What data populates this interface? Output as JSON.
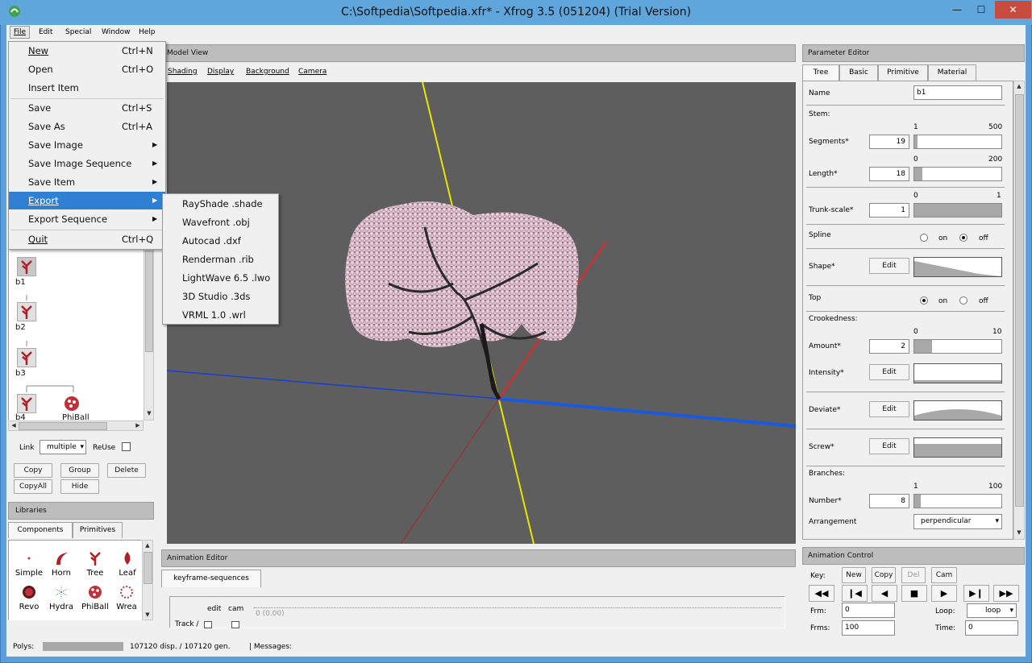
{
  "window": {
    "title": "C:\\Softpedia\\Softpedia.xfr* - Xfrog 3.5 (051204) (Trial Version)",
    "minimize": "—",
    "maximize": "☐",
    "close": "✕"
  },
  "menubar": [
    "File",
    "Edit",
    "Special",
    "Window",
    "Help"
  ],
  "file_menu": {
    "items": [
      {
        "label": "New",
        "shortcut": "Ctrl+N"
      },
      {
        "label": "Open",
        "shortcut": "Ctrl+O"
      },
      {
        "label": "Insert Item",
        "shortcut": ""
      },
      {
        "label": "Save",
        "shortcut": "Ctrl+S"
      },
      {
        "label": "Save As",
        "shortcut": "Ctrl+A"
      },
      {
        "label": "Save Image",
        "shortcut": ""
      },
      {
        "label": "Save Image Sequence",
        "shortcut": ""
      },
      {
        "label": "Save Item",
        "shortcut": ""
      },
      {
        "label": "Export",
        "shortcut": ""
      },
      {
        "label": "Export Sequence",
        "shortcut": ""
      },
      {
        "label": "Quit",
        "shortcut": "Ctrl+Q"
      }
    ],
    "submenu_arrow": "▶"
  },
  "export_submenu": [
    "RayShade .shade",
    "Wavefront .obj",
    "Autocad .dxf",
    "Renderman .rib",
    "LightWave 6.5 .lwo",
    "3D Studio .3ds",
    "VRML 1.0 .wrl"
  ],
  "hierarchy": {
    "nodes": [
      "b1",
      "b2",
      "b3",
      "b4",
      "PhiBall"
    ],
    "link_label": "Link",
    "link_value": "multiple",
    "reuse_label": "ReUse",
    "buttons": {
      "copy": "Copy",
      "group": "Group",
      "delete": "Delete",
      "copyall": "CopyAll",
      "hide": "Hide"
    }
  },
  "libraries": {
    "title": "Libraries",
    "tabs": [
      "Components",
      "Primitives"
    ],
    "items": [
      "Simple",
      "Horn",
      "Tree",
      "Leaf",
      "Revo",
      "Hydra",
      "PhiBall",
      "Wrea"
    ]
  },
  "model_view": {
    "title": "Model View",
    "menu": [
      "Shading",
      "Display",
      "Background",
      "Camera"
    ]
  },
  "animation_editor": {
    "title": "Animation Editor",
    "tab": "keyframe-sequences",
    "edit": "edit",
    "cam": "cam",
    "track": "Track /",
    "time": "0 (0.00)"
  },
  "parameter_editor": {
    "title": "Parameter Editor",
    "tabs": [
      "Tree",
      "Basic",
      "Primitive",
      "Material"
    ],
    "name_label": "Name",
    "name_value": "b1",
    "stem_label": "Stem:",
    "segments": {
      "label": "Segments*",
      "value": "19",
      "min": "1",
      "max": "500",
      "fraction": 0.036
    },
    "length": {
      "label": "Length*",
      "value": "18",
      "min": "0",
      "max": "200",
      "fraction": 0.09
    },
    "trunk_scale": {
      "label": "Trunk-scale*",
      "value": "1",
      "min": "0",
      "max": "1",
      "fraction": 1.0
    },
    "spline": {
      "label": "Spline",
      "on": "on",
      "off": "off",
      "selected": "off"
    },
    "shape": {
      "label": "Shape*",
      "button": "Edit"
    },
    "top": {
      "label": "Top",
      "on": "on",
      "off": "off",
      "selected": "on"
    },
    "crookedness_label": "Crookedness:",
    "amount": {
      "label": "Amount*",
      "value": "2",
      "min": "0",
      "max": "10",
      "fraction": 0.2
    },
    "intensity": {
      "label": "Intensity*",
      "button": "Edit"
    },
    "deviate": {
      "label": "Deviate*",
      "button": "Edit"
    },
    "screw": {
      "label": "Screw*",
      "button": "Edit"
    },
    "branches_label": "Branches:",
    "number": {
      "label": "Number*",
      "value": "8",
      "min": "1",
      "max": "100",
      "fraction": 0.07
    },
    "arrangement": {
      "label": "Arrangement",
      "value": "perpendicular"
    }
  },
  "animation_control": {
    "title": "Animation Control",
    "key_label": "Key:",
    "new": "New",
    "copy": "Copy",
    "del": "Del",
    "cam": "Cam",
    "frm_label": "Frm:",
    "frm_value": "0",
    "frms_label": "Frms:",
    "frms_value": "100",
    "loop_label": "Loop:",
    "loop_value": "loop",
    "time_label": "Time:",
    "time_value": "0"
  },
  "statusbar": {
    "polys_label": "Polys:",
    "polys_text": "107120 disp. / 107120 gen.",
    "messages": "| Messages:"
  },
  "colors": {
    "titlebar": "#5fa6dd",
    "highlight": "#2f7fd2",
    "viewport": "#5e5e5e",
    "blossom": "#e8c8d6"
  }
}
